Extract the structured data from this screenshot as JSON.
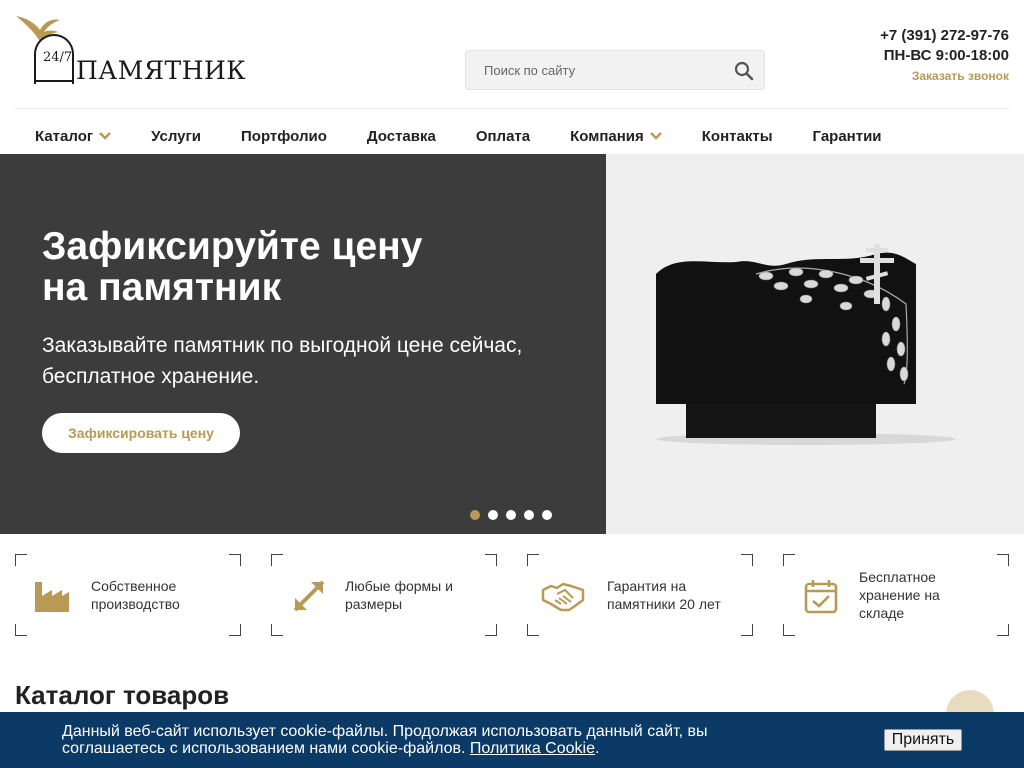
{
  "header": {
    "logo_text": "ПАМЯТНИК",
    "logo_badge": "24/7",
    "search": {
      "placeholder": "Поиск по сайту"
    },
    "phone": "+7 (391) 272-97-76",
    "hours": "ПН-ВС 9:00-18:00",
    "callback_label": "Заказать звонок"
  },
  "nav": [
    {
      "label": "Каталог",
      "has_dropdown": true
    },
    {
      "label": "Услуги",
      "has_dropdown": false
    },
    {
      "label": "Портфолио",
      "has_dropdown": false
    },
    {
      "label": "Доставка",
      "has_dropdown": false
    },
    {
      "label": "Оплата",
      "has_dropdown": false
    },
    {
      "label": "Компания",
      "has_dropdown": true
    },
    {
      "label": "Контакты",
      "has_dropdown": false
    },
    {
      "label": "Гарантии",
      "has_dropdown": false
    }
  ],
  "hero": {
    "title_line1": "Зафиксируйте цену",
    "title_line2": "на памятник",
    "subtitle_line1": "Заказывайте памятник по выгодной цене сейчас,",
    "subtitle_line2": "бесплатное хранение.",
    "button_label": "Зафиксировать цену",
    "slides_total": 5,
    "active_slide": 1
  },
  "features": [
    {
      "icon": "factory-icon",
      "line1": "Собственное",
      "line2": "производство",
      "line3": ""
    },
    {
      "icon": "resize-arrows-icon",
      "line1": "Любые формы и",
      "line2": "размеры",
      "line3": ""
    },
    {
      "icon": "handshake-icon",
      "line1": "Гарантия на",
      "line2": "памятники 20 лет",
      "line3": ""
    },
    {
      "icon": "calendar-check-icon",
      "line1": "Бесплатное",
      "line2": "хранение на",
      "line3": "складе"
    }
  ],
  "catalog": {
    "title": "Каталог товаров"
  },
  "cookie": {
    "text_line1": "Данный веб-сайт использует cookie-файлы. Продолжая использовать данный сайт, вы",
    "text_line2": "соглашаетесь с использованием нами cookie-файлов.",
    "link_label": "Политика Cookie",
    "period": ".",
    "accept_label": "Принять"
  },
  "colors": {
    "accent": "#b99a55",
    "hero_dark": "#3c3c3c",
    "cookie_bg": "#0b3a66"
  }
}
